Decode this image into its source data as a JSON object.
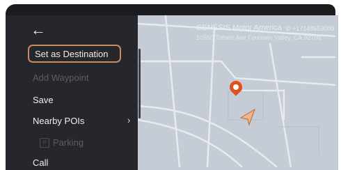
{
  "menu": {
    "back_icon": "back-arrow-icon",
    "items": [
      {
        "label": "Set as Destination",
        "state": "selected"
      },
      {
        "label": "Add Waypoint",
        "state": "disabled"
      },
      {
        "label": "Save",
        "state": "normal"
      },
      {
        "label": "Nearby POIs",
        "state": "normal",
        "icon": "chevron-right-icon"
      },
      {
        "label": "Parking",
        "state": "disabled",
        "icon": "parking-icon"
      },
      {
        "label": "Call",
        "state": "normal"
      }
    ]
  },
  "location": {
    "name": "GENESIS Motor America",
    "phone": "+17149653000",
    "address": "10550 Talbert Ave Fountain Valley, CA 92708"
  },
  "colors": {
    "selected_border": "#c98a63",
    "pin": "#e2501c",
    "car_arrow": "#f0b48a"
  }
}
